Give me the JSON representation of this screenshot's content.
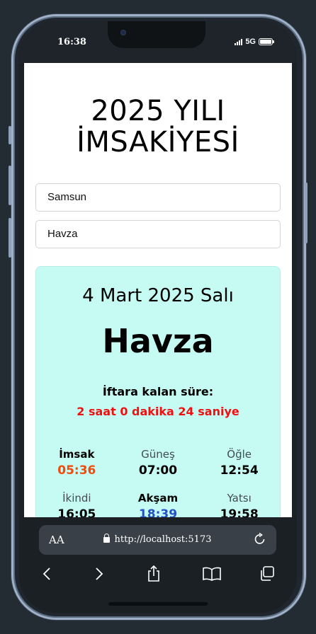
{
  "status_bar": {
    "time": "16:38",
    "network": "5G"
  },
  "page": {
    "title_line1": "2025 YILI",
    "title_line2": "İMSAKİYESİ"
  },
  "selects": {
    "city": "Samsun",
    "district": "Havza"
  },
  "card": {
    "date": "4 Mart 2025 Salı",
    "district": "Havza",
    "countdown_label": "İftara kalan süre:",
    "countdown_value": "2 saat 0 dakika 24 saniye",
    "times": [
      {
        "name": "İmsak",
        "value": "05:36"
      },
      {
        "name": "Güneş",
        "value": "07:00"
      },
      {
        "name": "Öğle",
        "value": "12:54"
      },
      {
        "name": "İkindi",
        "value": "16:05"
      },
      {
        "name": "Akşam",
        "value": "18:39"
      },
      {
        "name": "Yatsı",
        "value": "19:58"
      }
    ]
  },
  "browser": {
    "text_size_label": "AA",
    "url": "http://localhost:5173"
  },
  "colors": {
    "card_bg": "#c5fbf2",
    "countdown": "#ef1111",
    "imsak": "#f24a0c",
    "aksam": "#2350c9"
  }
}
